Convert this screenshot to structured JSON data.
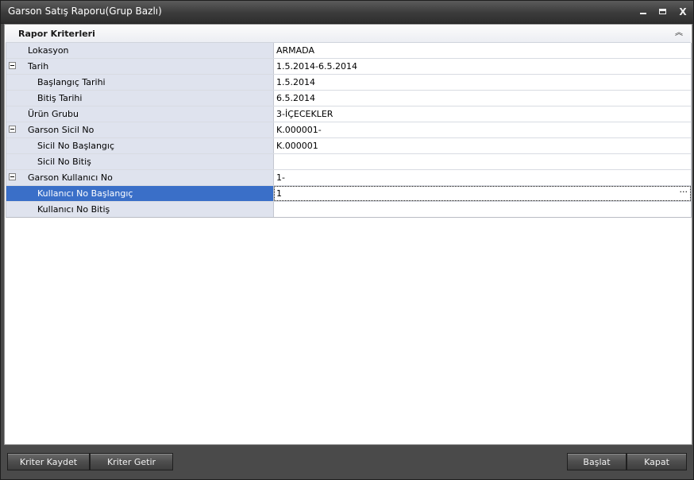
{
  "window": {
    "title": "Garson Satış Raporu(Grup Bazlı)",
    "controls": {
      "minimize": "minimize",
      "maximize": "maximize",
      "close": "X"
    }
  },
  "criteria": {
    "header": "Rapor Kriterleri",
    "rows": [
      {
        "label": "Lokasyon",
        "value": "ARMADA"
      },
      {
        "label": "Tarih",
        "value": "1.5.2014-6.5.2014"
      },
      {
        "label": "Başlangıç Tarihi",
        "value": "1.5.2014"
      },
      {
        "label": "Bitiş Tarihi",
        "value": "6.5.2014"
      },
      {
        "label": "Ürün Grubu",
        "value": "3-İÇECEKLER"
      },
      {
        "label": "Garson Sicil No",
        "value": "K.000001-"
      },
      {
        "label": "Sicil No Başlangıç",
        "value": "K.000001"
      },
      {
        "label": "Sicil No Bitiş",
        "value": ""
      },
      {
        "label": "Garson Kullanıcı No",
        "value": "1-"
      },
      {
        "label": "Kullanıcı No Başlangıç",
        "value": "1"
      },
      {
        "label": "Kullanıcı No Bitiş",
        "value": ""
      }
    ],
    "ellipsis": "···"
  },
  "buttons": {
    "save_criteria": "Kriter Kaydet",
    "load_criteria": "Kriter Getir",
    "start": "Başlat",
    "close": "Kapat"
  }
}
